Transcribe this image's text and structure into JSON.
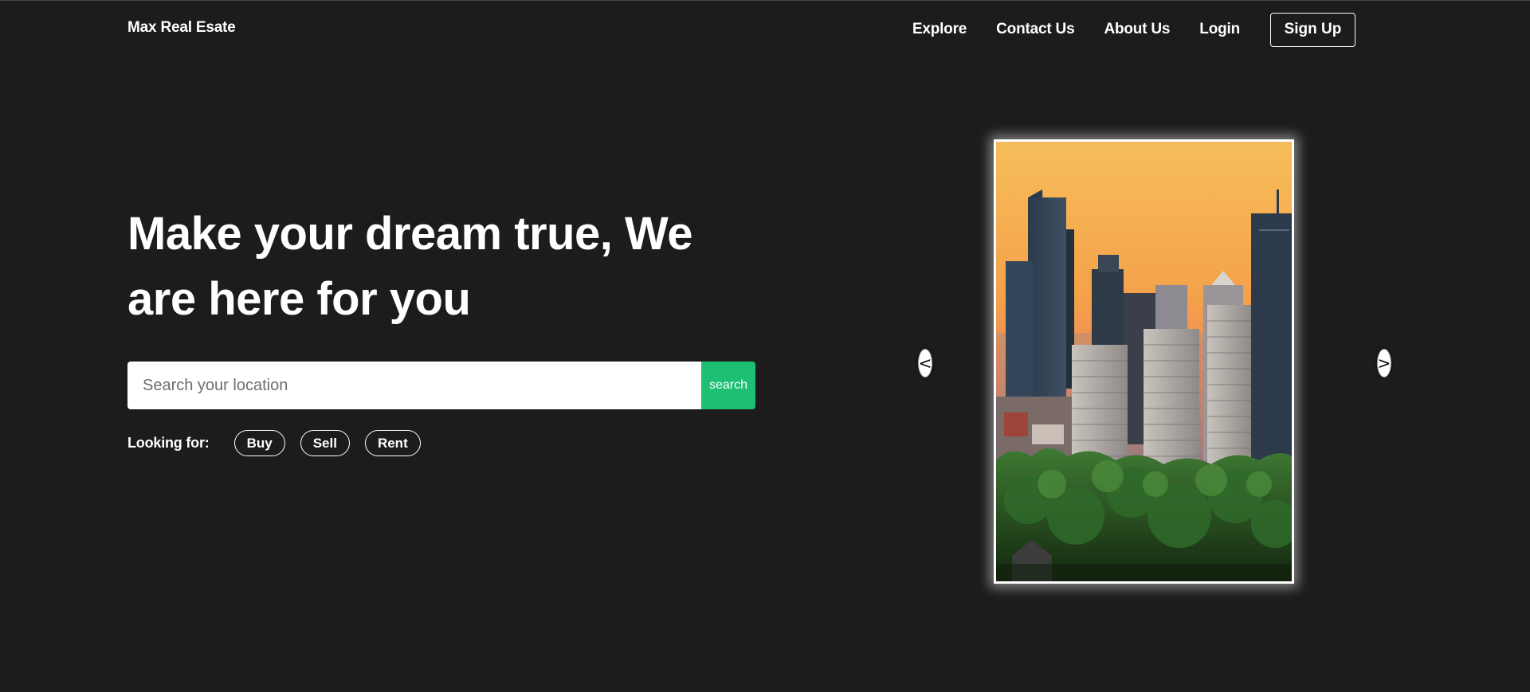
{
  "header": {
    "brand": "Max Real Esate",
    "nav": [
      "Explore",
      "Contact Us",
      "About Us",
      "Login"
    ],
    "signup_label": "Sign Up"
  },
  "hero": {
    "title": "Make your dream true, We are here for you",
    "search": {
      "placeholder": "Search your location",
      "value": "",
      "button_label": "search"
    },
    "looking_for": {
      "label": "Looking for:",
      "options": [
        "Buy",
        "Sell",
        "Rent"
      ]
    }
  },
  "carousel": {
    "prev_label": "<",
    "next_label": ">"
  },
  "colors": {
    "background": "#1c1c1d",
    "accent": "#1dbf73",
    "text": "#ffffff"
  }
}
